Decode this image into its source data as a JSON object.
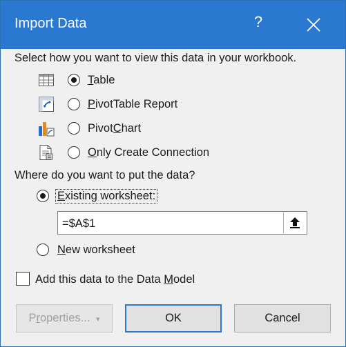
{
  "dialog": {
    "title": "Import Data",
    "help_glyph": "?",
    "accent_color": "#2b78d0"
  },
  "view": {
    "prompt": "Select how you want to view this data in your workbook.",
    "selected": "table",
    "options": [
      {
        "id": "table",
        "pre": "",
        "u": "T",
        "post": "able",
        "icon": "table-icon"
      },
      {
        "id": "pivottable",
        "pre": "",
        "u": "P",
        "post": "ivotTable Report",
        "icon": "pivottable-icon"
      },
      {
        "id": "pivotchart",
        "pre": "Pivot",
        "u": "C",
        "post": "hart",
        "icon": "pivotchart-icon"
      },
      {
        "id": "connection",
        "pre": "",
        "u": "O",
        "post": "nly Create Connection",
        "icon": "connection-icon"
      }
    ]
  },
  "location": {
    "prompt": "Where do you want to put the data?",
    "selected": "existing",
    "existing": {
      "pre": "",
      "u": "E",
      "post": "xisting worksheet:"
    },
    "reference_value": "=$A$1",
    "new": {
      "pre": "",
      "u": "N",
      "post": "ew worksheet"
    }
  },
  "data_model": {
    "pre": "Add this data to the Data ",
    "u": "M",
    "post": "odel",
    "checked": false
  },
  "buttons": {
    "properties": {
      "pre": "P",
      "u": "r",
      "post": "operties...",
      "arrow": "▾"
    },
    "ok": "OK",
    "cancel": "Cancel"
  }
}
